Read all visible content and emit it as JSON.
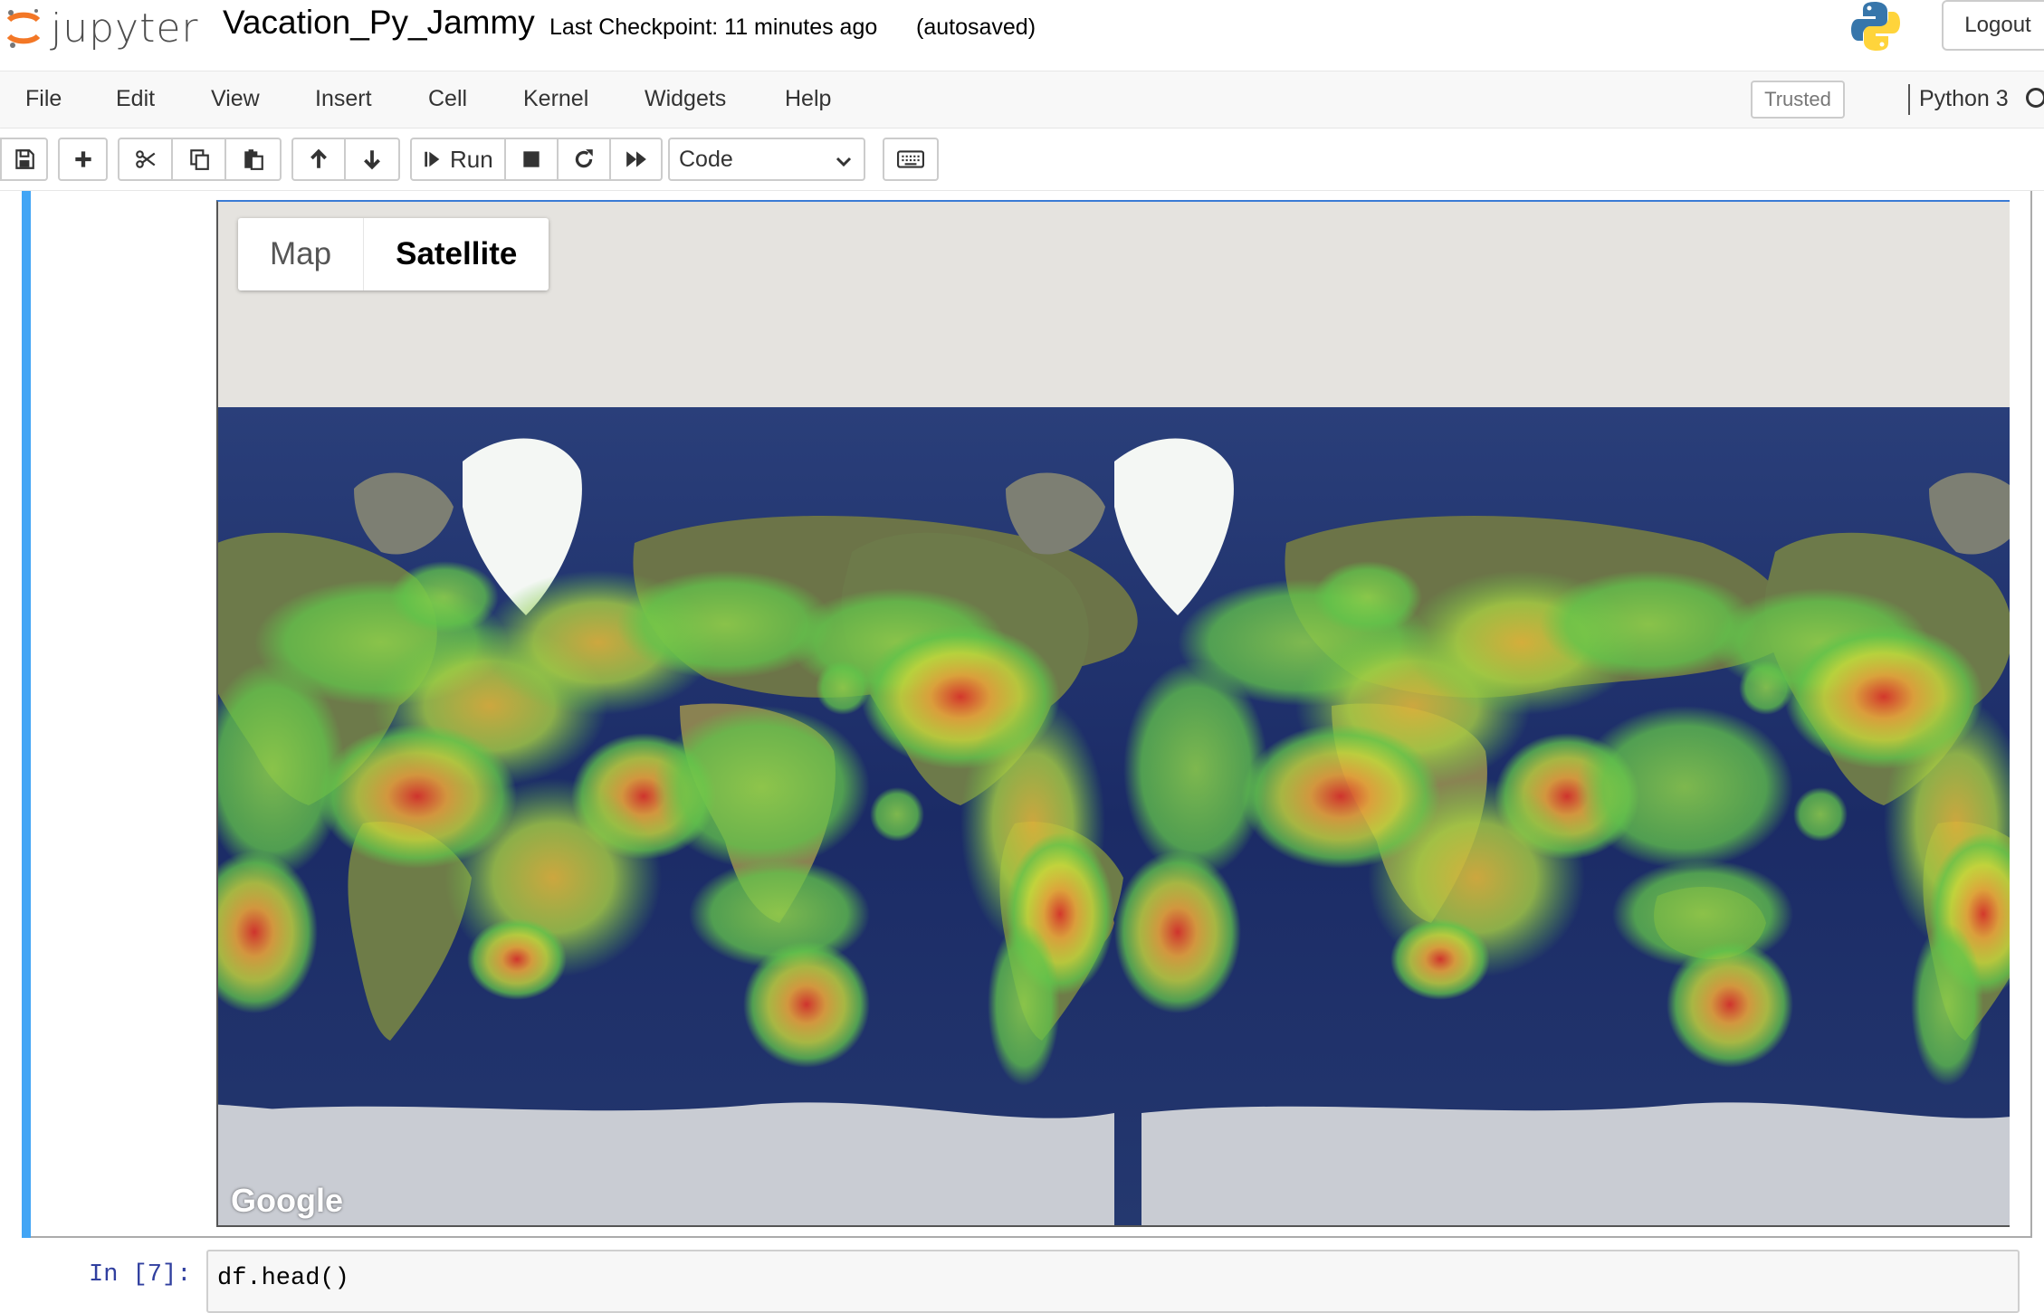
{
  "header": {
    "logo_text": "jupyter",
    "notebook_name": "Vacation_Py_Jammy",
    "checkpoint": "Last Checkpoint: 11 minutes ago",
    "autosave": "(autosaved)",
    "logout": "Logout"
  },
  "menubar": {
    "items": [
      "File",
      "Edit",
      "View",
      "Insert",
      "Cell",
      "Kernel",
      "Widgets",
      "Help"
    ],
    "trusted": "Trusted",
    "kernel": "Python 3"
  },
  "toolbar": {
    "run_label": "Run",
    "cell_type": "Code",
    "icons": [
      "save-icon",
      "plus-icon",
      "scissors-icon",
      "copy-icon",
      "paste-icon",
      "arrow-up-icon",
      "arrow-down-icon",
      "run-icon",
      "stop-icon",
      "restart-icon",
      "fast-forward-icon",
      "keyboard-icon"
    ]
  },
  "map": {
    "tabs": [
      "Map",
      "Satellite"
    ],
    "active_tab": "Satellite",
    "attribution": "Google",
    "heatmap_colors": [
      "#62c44a",
      "#c9d83a",
      "#e6a23a",
      "#d8342a"
    ]
  },
  "next_cell": {
    "prompt": "In [7]:",
    "code": "df.head()"
  }
}
